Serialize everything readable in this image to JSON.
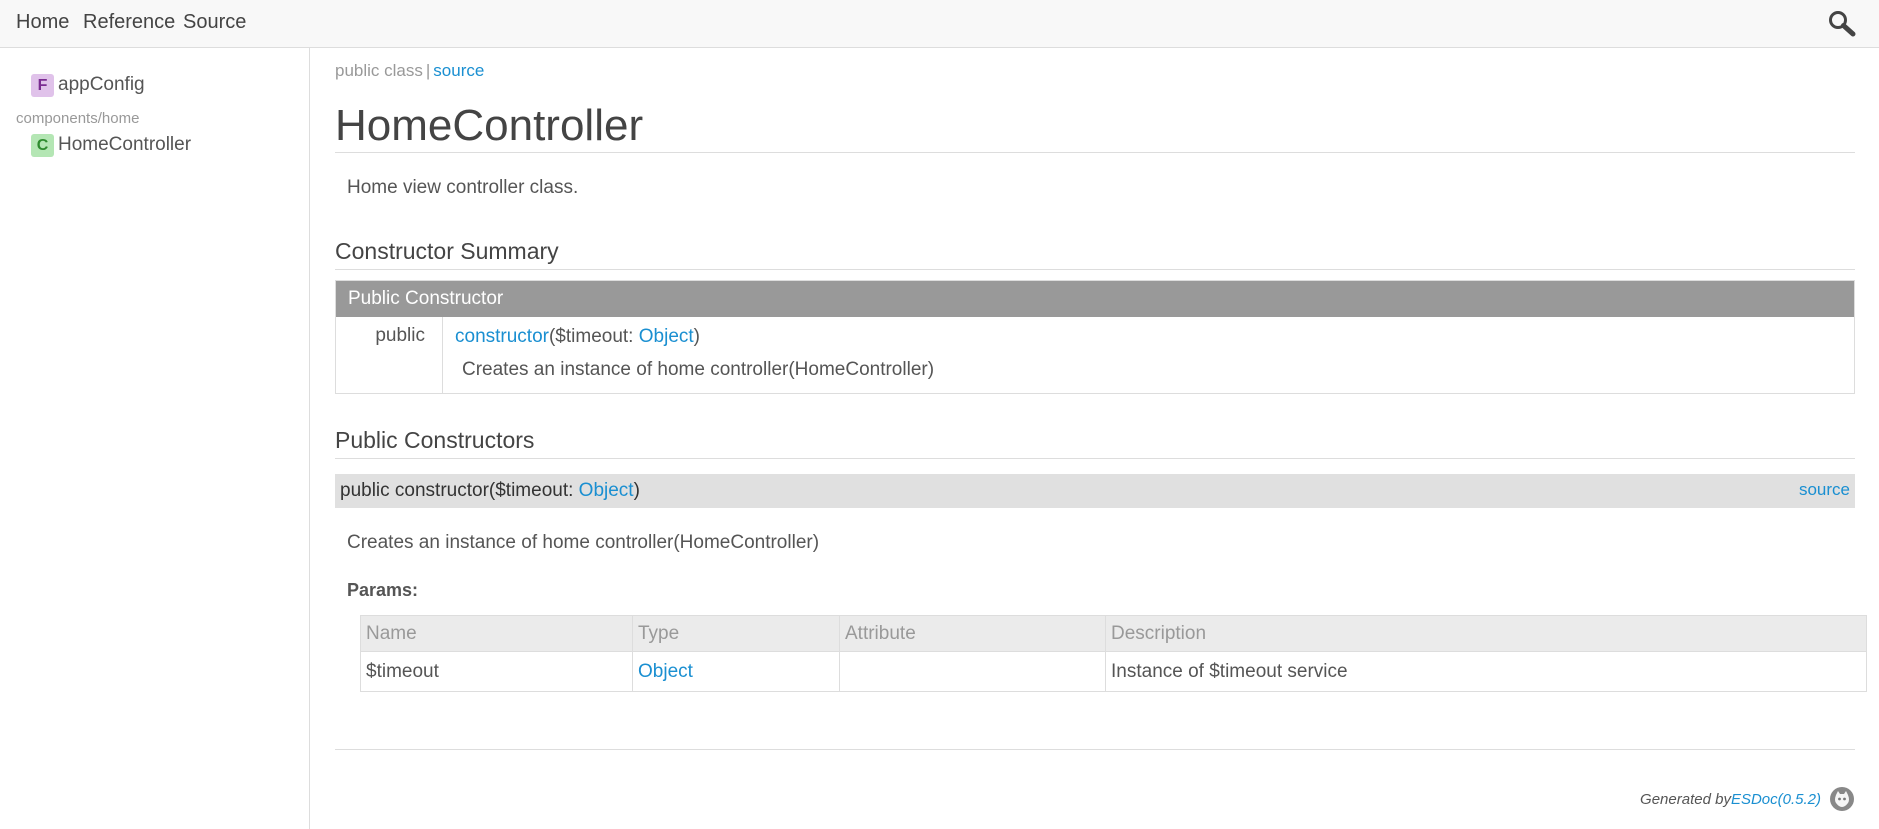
{
  "header": {
    "nav": [
      "Home",
      "Reference",
      "Source"
    ],
    "search_icon": "search-icon"
  },
  "sidebar": {
    "items": [
      {
        "kind": "F",
        "label": "appConfig"
      },
      {
        "kind": "C",
        "label": "HomeController"
      }
    ],
    "directory": "components/home"
  },
  "content": {
    "notice": {
      "access": "public class",
      "separator": "|",
      "source_link": "source"
    },
    "title": "HomeController",
    "description": "Home view controller class.",
    "constructor_summary": {
      "section_title": "Constructor Summary",
      "table_header": "Public Constructor",
      "row": {
        "access": "public",
        "name": "constructor",
        "sig_open": "($timeout: ",
        "type": "Object",
        "sig_close": ")",
        "description": "Creates an instance of home controller(HomeController)"
      }
    },
    "public_constructors": {
      "section_title": "Public Constructors",
      "signature_prefix": "public constructor($timeout: ",
      "type": "Object",
      "signature_suffix": ")",
      "source_link": "source",
      "description": "Creates an instance of home controller(HomeController)",
      "params_label": "Params:",
      "params_columns": [
        "Name",
        "Type",
        "Attribute",
        "Description"
      ],
      "params_rows": [
        {
          "name": "$timeout",
          "type": "Object",
          "attribute": "",
          "description": "Instance of $timeout service"
        }
      ]
    },
    "footer": {
      "generated_by": "Generated by ",
      "tool": "ESDoc(0.5.2)"
    }
  },
  "colors": {
    "link": "#1a8fd1",
    "summary_header_bg": "#999999",
    "detail_bar_bg": "#e0e0e0",
    "badge_function_bg": "#e0c2ea",
    "badge_class_bg": "#b4e6b4"
  }
}
